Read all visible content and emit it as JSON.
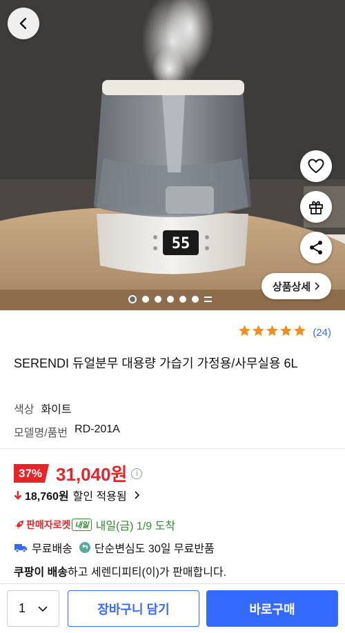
{
  "gallery": {
    "back_icon": "chevron-left-icon",
    "side_actions": [
      "heart-icon",
      "gift-icon",
      "share-icon"
    ],
    "detail_button_label": "상품상세",
    "page_count": 6,
    "current_page": 1,
    "display_reading": "55"
  },
  "rating": {
    "stars": 5,
    "count_label": "(24)"
  },
  "product": {
    "title": "SERENDI 듀얼분무 대용량 가습기 가정용/사무실용 6L",
    "options": [
      {
        "key": "색상",
        "value": "화이트"
      },
      {
        "key": "모델명/품번",
        "value": "RD-201A"
      }
    ]
  },
  "price": {
    "discount_percent": "37%",
    "sale_price": "31,040원",
    "discount_amount": "18,760원",
    "discount_label": "할인 적용됨",
    "accent_color": "#e52528"
  },
  "delivery": {
    "rocket_label": "판매자로켓",
    "tomorrow_badge": "내일",
    "arrival": "내일(금) 1/9 도착",
    "free_shipping": "무료배송",
    "return_policy": "단순변심도 30일 무료반품"
  },
  "seller": {
    "bold": "쿠팡이 배송",
    "rest": "하고 세렌디피티(이)가 판매합니다."
  },
  "bottom": {
    "quantity": "1",
    "cart_label": "장바구니 담기",
    "buy_label": "바로구매",
    "brand_color": "#346aff"
  }
}
